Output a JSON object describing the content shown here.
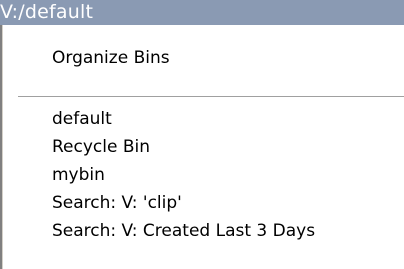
{
  "header": {
    "title": "V:/default"
  },
  "menu": {
    "top_item": "Organize Bins",
    "bins": [
      "default",
      "Recycle Bin",
      "mybin",
      "Search: V: 'clip'",
      "Search: V: Created Last 3 Days"
    ]
  },
  "colors": {
    "header_background": "#8a9ab3",
    "header_text": "#ffffff",
    "menu_background": "#ffffff"
  }
}
